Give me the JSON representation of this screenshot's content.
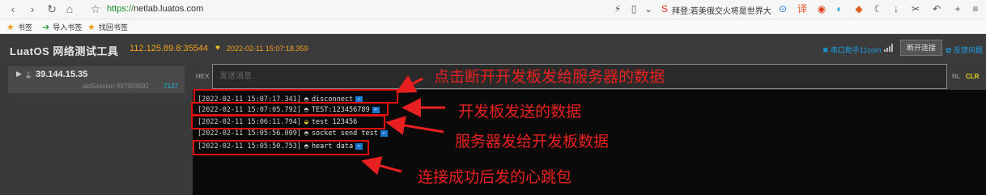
{
  "browser": {
    "url_protocol": "https://",
    "url_host": "netlab.luatos.com",
    "search_hint": "拜登:若美俄交火将是世界大",
    "bookmarks": [
      {
        "label": "书签"
      },
      {
        "label": "导入书签"
      },
      {
        "label": "找回书签"
      }
    ]
  },
  "app": {
    "title": "LuatOS 网络测试工具",
    "server_address": "112.125.89.8:35544",
    "header_date": "2022-02-11 15:07:18.359",
    "serial_helper_link": "串口助手11com",
    "disconnect_button": "断开连接",
    "feedback_link": "反馈问题"
  },
  "connection": {
    "ip": "39.144.15.35",
    "session": "aidSession-997903992",
    "port": ":7127"
  },
  "send": {
    "hex_label": "HEX",
    "placeholder": "发送消息",
    "nl_label": "NL",
    "clr_label": "CLR"
  },
  "log": [
    {
      "timestamp": "[2022-02-11 15:07:17.341]",
      "direction": "in",
      "message": "disconnect"
    },
    {
      "timestamp": "[2022-02-11 15:07:05.792]",
      "direction": "in",
      "message": "TEST:123456789"
    },
    {
      "timestamp": "[2022-02-11 15:06:11.794]",
      "direction": "out",
      "message": "test 123456"
    },
    {
      "timestamp": "[2022-02-11 15:05:56.009]",
      "direction": "in",
      "message": "socket send test"
    },
    {
      "timestamp": "[2022-02-11 15:05:50.753]",
      "direction": "in",
      "message": "heart data"
    }
  ],
  "annotations": {
    "disconnect_note": "点击断开开发板发给服务器的数据",
    "board_send_note": "开发板发送的数据",
    "server_send_note": "服务器发给开发板数据",
    "heartbeat_note": "连接成功后发的心跳包"
  },
  "colors": {
    "accent_orange": "#f0a020",
    "link_blue": "#1aa0e8",
    "annotation_red": "#e82020"
  }
}
